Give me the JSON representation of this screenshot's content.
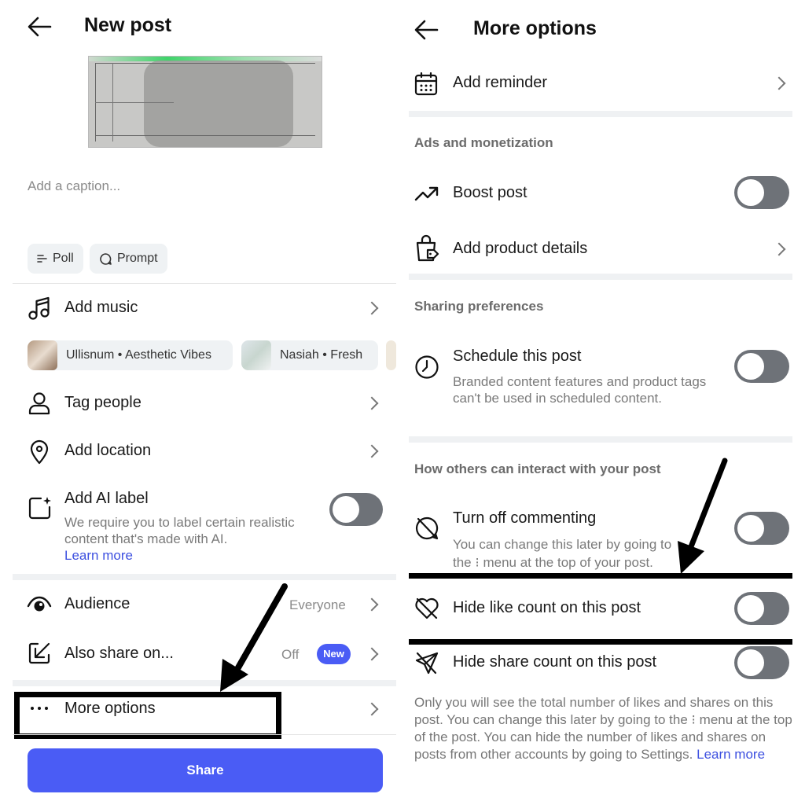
{
  "left": {
    "title": "New post",
    "caption_placeholder": "Add a caption...",
    "chips": {
      "poll": "Poll",
      "prompt": "Prompt"
    },
    "add_music": "Add music",
    "music": [
      {
        "label": "Ullisnum • Aesthetic Vibes"
      },
      {
        "label": "Nasiah • Fresh"
      }
    ],
    "tag_people": "Tag people",
    "add_location": "Add location",
    "ai_label": {
      "title": "Add AI label",
      "description": "We require you to label certain realistic content that's made with AI.",
      "learn_more": "Learn more"
    },
    "audience": {
      "label": "Audience",
      "value": "Everyone"
    },
    "also_share": {
      "label": "Also share on...",
      "value": "Off",
      "badge": "New"
    },
    "more_options": "More options",
    "share_button": "Share",
    "colors": {
      "primary": "#4a5cf5",
      "badge": "#4a5cf5"
    }
  },
  "right": {
    "title": "More options",
    "add_reminder": "Add reminder",
    "section_ads": "Ads and monetization",
    "boost_post": "Boost post",
    "add_product_details": "Add product details",
    "section_sharing": "Sharing preferences",
    "schedule": {
      "title": "Schedule this post",
      "description": "Branded content features and product tags can't be used in scheduled content."
    },
    "section_interact": "How others can interact with your post",
    "commenting": {
      "title": "Turn off commenting",
      "description_1": "You can change this later by going to",
      "description_2": "the ⁝ menu at the top of your post."
    },
    "hide_like": "Hide like count on this post",
    "hide_share": "Hide share count on this post",
    "footer_text": "Only you will see the total number of likes and shares on this post. You can change this later by going to the ⁝ menu at the top of the post. You can hide the number of likes and shares on posts from other accounts by going to Settings.",
    "footer_link": "Learn more"
  }
}
